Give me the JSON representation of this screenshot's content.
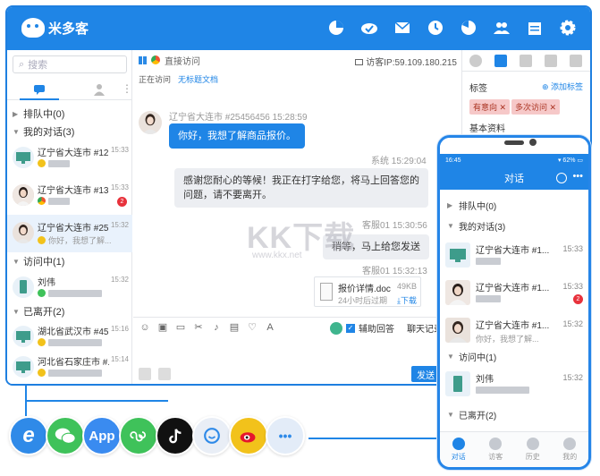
{
  "brand": {
    "name": "米多客",
    "accent": "#1f85e6"
  },
  "top_icons": [
    "pie-chart-icon",
    "cloud-check-icon",
    "mail-icon",
    "clock-icon",
    "chart-icon",
    "users-icon",
    "calendar-icon",
    "gear-icon"
  ],
  "left": {
    "search_placeholder": "搜索",
    "groups": {
      "queue": "排队中(0)",
      "mine": "我的对话(3)",
      "visiting": "访问中(1)",
      "left": "已离开(2)"
    },
    "conversations": [
      {
        "name": "辽宁省大连市 #12...",
        "time": "15:33",
        "sub": "",
        "badge": ""
      },
      {
        "name": "辽宁省大连市 #13...",
        "time": "15:33",
        "sub": "",
        "badge": "2"
      },
      {
        "name": "辽宁省大连市 #25...",
        "time": "15:32",
        "sub": "你好，我想了解...",
        "badge": ""
      }
    ],
    "visitors": [
      {
        "name": "刘伟",
        "time": "15:32"
      }
    ],
    "departed": [
      {
        "name": "湖北省武汉市 #45...",
        "time": "15:16"
      },
      {
        "name": "河北省石家庄市 #...",
        "time": "15:14"
      }
    ]
  },
  "chat": {
    "header": "直接访问",
    "ip": "访客IP:59.109.180.215",
    "status": "正在访问",
    "doc_link": "无标题文档",
    "visitor_meta": "辽宁省大连市 #25456456 15:28:59",
    "visitor_msg": "你好，我想了解商品报价。",
    "system_meta": "系统 15:29:04",
    "system_msg": "感谢您耐心的等候！我正在打字给您，将马上回答您的问题，请不要离开。",
    "agent_meta1": "客服01 15:30:56",
    "agent_msg1": "稍等，马上给您发送",
    "agent_meta2": "客服01 15:32:13",
    "file_name": "报价详情.doc",
    "file_size": "49KB",
    "file_expiry": "24小时后过期",
    "file_download": "下载",
    "assist_label": "辅助回答",
    "history_label": "聊天记录",
    "send_label": "发送"
  },
  "right": {
    "tags_title": "标签",
    "add_tag": "添加标签",
    "tags": [
      "有意向",
      "多次访问"
    ],
    "basic_info": "基本资料"
  },
  "phone": {
    "time": "16:45",
    "battery": "62%",
    "title": "对话",
    "groups": {
      "queue": "排队中(0)",
      "mine": "我的对话(3)",
      "visiting": "访问中(1)",
      "left": "已离开(2)"
    },
    "conversations": [
      {
        "name": "辽宁省大连市 #1...",
        "time": "15:33",
        "sub": "",
        "badge": ""
      },
      {
        "name": "辽宁省大连市 #1...",
        "time": "15:33",
        "sub": "",
        "badge": "2"
      },
      {
        "name": "辽宁省大连市 #1...",
        "time": "15:32",
        "sub": "你好，我想了解...",
        "badge": ""
      }
    ],
    "visitor": {
      "name": "刘伟",
      "time": "15:32"
    },
    "tabs": [
      "对话",
      "访客",
      "历史",
      "我的"
    ]
  },
  "channels": [
    {
      "id": "ie",
      "label": "e",
      "color": "#2f8ae8"
    },
    {
      "id": "wechat",
      "label": "",
      "color": "#3fc25a"
    },
    {
      "id": "app",
      "label": "App",
      "color": "#3a8bf0"
    },
    {
      "id": "miniprogram",
      "label": "",
      "color": "#3fc25a"
    },
    {
      "id": "douyin",
      "label": "",
      "color": "#111111"
    },
    {
      "id": "chat",
      "label": "",
      "color": "#e9eef6"
    },
    {
      "id": "weibo",
      "label": "",
      "color": "#f2c21b"
    },
    {
      "id": "more",
      "label": "•••",
      "color": "#e3ecf8"
    }
  ],
  "watermark": {
    "main": "KK下载",
    "sub": "www.kkx.net"
  }
}
